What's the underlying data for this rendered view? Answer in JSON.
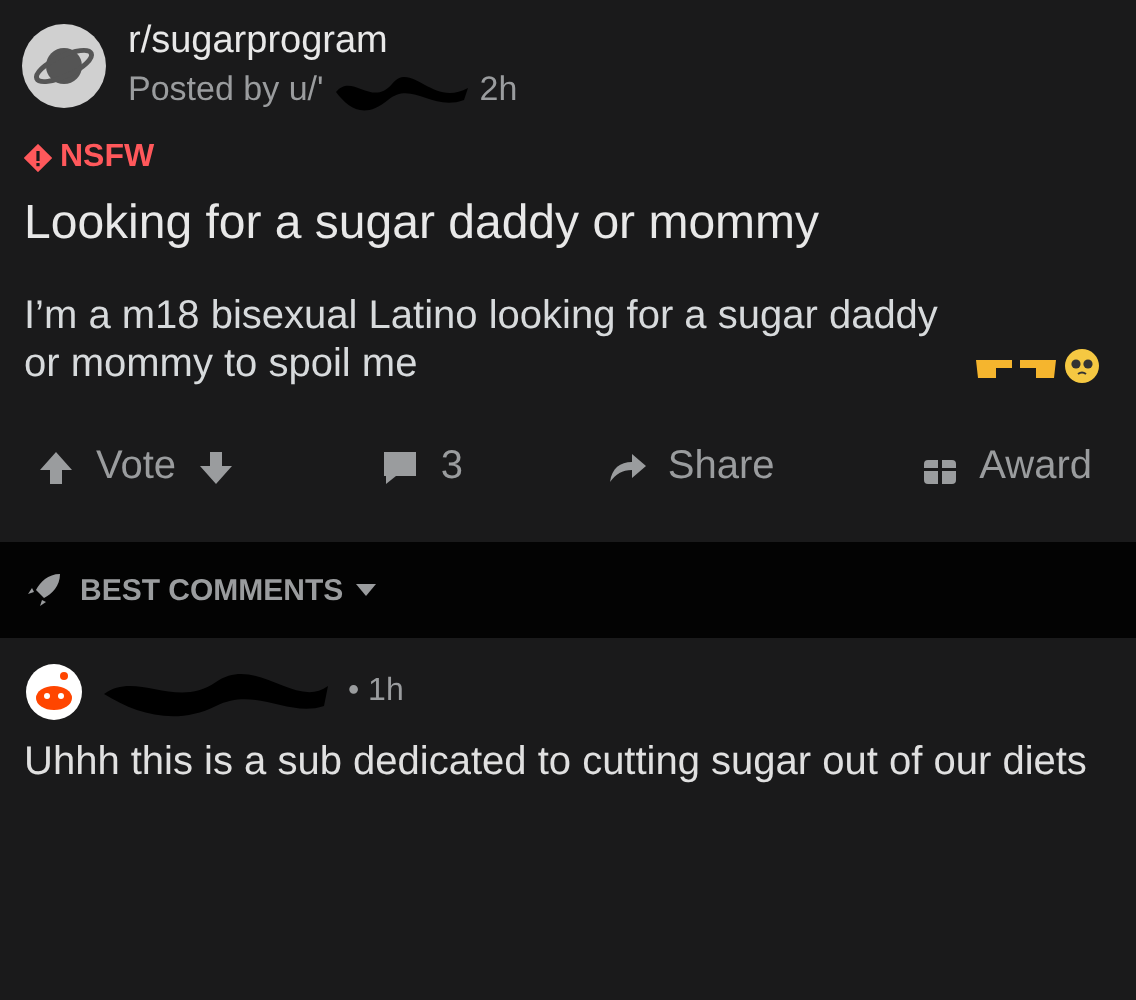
{
  "post": {
    "subreddit": "r/sugarprogram",
    "posted_by": "Posted by u/'",
    "age": "2h",
    "flag": "NSFW",
    "title": "Looking for a sugar daddy or mommy",
    "body": "I’m a m18 bisexual Latino looking for a sugar daddy or mommy to spoil me"
  },
  "actions": {
    "vote": "Vote",
    "comments": "3",
    "share": "Share",
    "award": "Award"
  },
  "sort": {
    "label": "BEST COMMENTS"
  },
  "comments": [
    {
      "age": "• 1h",
      "text": "Uhhh this is a sub dedicated to cutting sugar out of our diets"
    }
  ]
}
